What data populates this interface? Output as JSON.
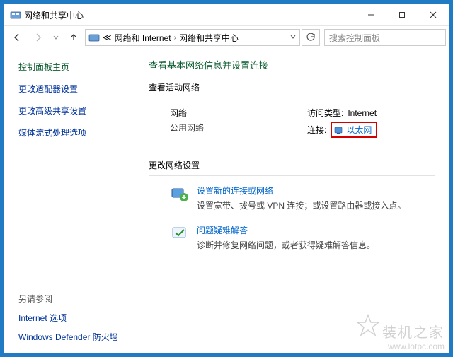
{
  "window": {
    "title": "网络和共享中心"
  },
  "breadcrumbs": {
    "root_symbol": "≪",
    "level1": "网络和 Internet",
    "level2": "网络和共享中心"
  },
  "search": {
    "placeholder": "搜索控制面板"
  },
  "sidebar": {
    "heading": "控制面板主页",
    "items": [
      {
        "label": "更改适配器设置"
      },
      {
        "label": "更改高级共享设置"
      },
      {
        "label": "媒体流式处理选项"
      }
    ]
  },
  "main": {
    "title": "查看基本网络信息并设置连接",
    "active_networks_label": "查看活动网络",
    "network": {
      "name": "网络",
      "type": "公用网络",
      "access_type_label": "访问类型:",
      "access_type_value": "Internet",
      "connection_label": "连接:",
      "connection_value": "以太网"
    },
    "change_settings_label": "更改网络设置",
    "actions": [
      {
        "title": "设置新的连接或网络",
        "desc": "设置宽带、拨号或 VPN 连接；或设置路由器或接入点。"
      },
      {
        "title": "问题疑难解答",
        "desc": "诊断并修复网络问题，或者获得疑难解答信息。"
      }
    ]
  },
  "see_also": {
    "heading": "另请参阅",
    "items": [
      {
        "label": "Internet 选项"
      },
      {
        "label": "Windows Defender 防火墙"
      }
    ]
  },
  "watermark": {
    "line1": "装机之家",
    "line2": "www.lotpc.com"
  }
}
